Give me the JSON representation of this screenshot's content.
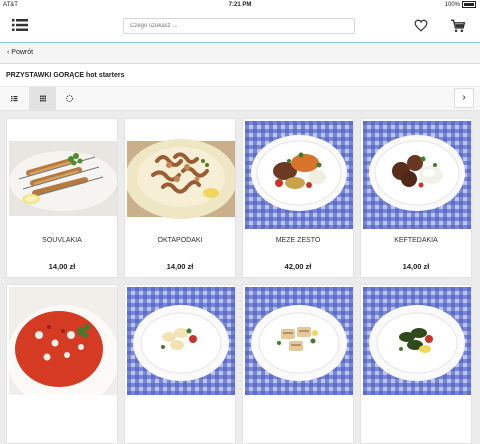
{
  "status": {
    "carrier": "AT&T",
    "time": "7:21 PM",
    "battery": "100%"
  },
  "search": {
    "placeholder": "Czego szukasz ..."
  },
  "nav": {
    "back_label": "Powrót"
  },
  "category": {
    "title": "PRZYSTAWKI GORĄCE hot starters"
  },
  "icons": {
    "menu": "menu-icon",
    "wishlist": "heart-icon",
    "cart": "cart-icon",
    "list_view": "list-view-icon",
    "grid_view": "grid-view-icon",
    "spinner": "loading-icon",
    "next": "chevron-right-icon"
  },
  "products": [
    {
      "name": "SOUVLAKIA",
      "price": "14,00 zł",
      "image": "skewers-on-plate"
    },
    {
      "name": "OKTAPODAKI",
      "price": "14,00 zł",
      "image": "octopus-on-plate"
    },
    {
      "name": "MEZE ZESTO",
      "price": "42,00 zł",
      "image": "meze-platter-checkered"
    },
    {
      "name": "KEFTEDAKIA",
      "price": "14,00 zł",
      "image": "meatballs-checkered"
    },
    {
      "name": "",
      "price": "",
      "image": "tomato-salad"
    },
    {
      "name": "",
      "price": "",
      "image": "plate-checkered"
    },
    {
      "name": "",
      "price": "",
      "image": "halloumi-checkered"
    },
    {
      "name": "",
      "price": "",
      "image": "dolmades-checkered"
    }
  ]
}
